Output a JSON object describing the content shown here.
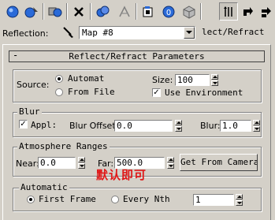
{
  "toolbar": {
    "icons": [
      "get-material-icon",
      "put-to-scene-icon",
      "assign-to-selection-icon",
      "reset-map-icon",
      "make-unique-icon",
      "put-to-library-icon",
      "material-id-channel-icon",
      "show-map-in-viewport-icon",
      "show-end-result-icon",
      "go-to-parent-icon",
      "go-forward-to-sibling-icon"
    ],
    "material_id": "0"
  },
  "reflection": {
    "label": "Reflection:",
    "map_value": "Map #8",
    "map_type": "lect/Refract"
  },
  "rollout": {
    "minus": "-",
    "title": "Reflect/Refract Parameters"
  },
  "source": {
    "label": "Source:",
    "options": [
      "Automat",
      "From File"
    ],
    "selected": "Automat",
    "size_label": "Size:",
    "size_value": "100",
    "use_env_label": "Use Environment",
    "use_env_checked": true
  },
  "blur": {
    "group_label": "Blur",
    "apply_label": "Appl:",
    "apply_checked": true,
    "offset_label": "Blur Offset:",
    "offset_value": "0.0",
    "blur_label": "Blur:",
    "blur_value": "1.0"
  },
  "atmosphere": {
    "group_label": "Atmosphere Ranges",
    "near_label": "Near:",
    "near_value": "0.0",
    "far_label": "Far:",
    "far_value": "500.0",
    "get_camera_label": "Get From Camera"
  },
  "annotation": {
    "text": "默认即可",
    "color": "#e01818"
  },
  "automatic": {
    "group_label": "Automatic",
    "options": [
      "First Frame",
      "Every Nth"
    ],
    "selected": "First Frame",
    "nth_value": "1"
  }
}
